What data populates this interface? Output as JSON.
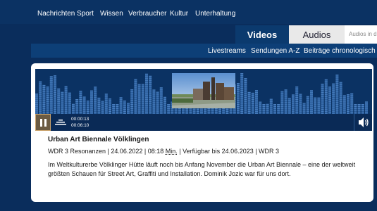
{
  "top_nav": [
    "Nachrichten",
    "Sport",
    "Wissen",
    "Verbraucher",
    "Kultur",
    "Unterhaltung"
  ],
  "tabs": {
    "videos": "Videos",
    "audios": "Audios"
  },
  "search": {
    "placeholder": "Audios in d"
  },
  "sub_nav": [
    "Livestreams",
    "Sendungen A-Z",
    "Beiträge chronologisch"
  ],
  "player": {
    "current_time": "00:00:13",
    "total_time": "00:06:10",
    "accent_color": "#c9a26a",
    "play_state_icon": "pause-icon",
    "volume_icon": "speaker-icon"
  },
  "item": {
    "title": "Urban Art Biennale Völklingen",
    "meta_prefix": "WDR 3 Resonanzen | 24.06.2022 | 08:18 ",
    "meta_min": "Min.",
    "meta_suffix": " | Verfügbar bis 24.06.2023 | WDR 3",
    "description": "Im Weltkulturerbe Völklinger Hütte läuft noch bis Anfang November die Urban Art Biennale – eine der weltweit größten Schauen für Street Art, Graffiti und Installation. Dominik Jozic war für uns dort."
  }
}
